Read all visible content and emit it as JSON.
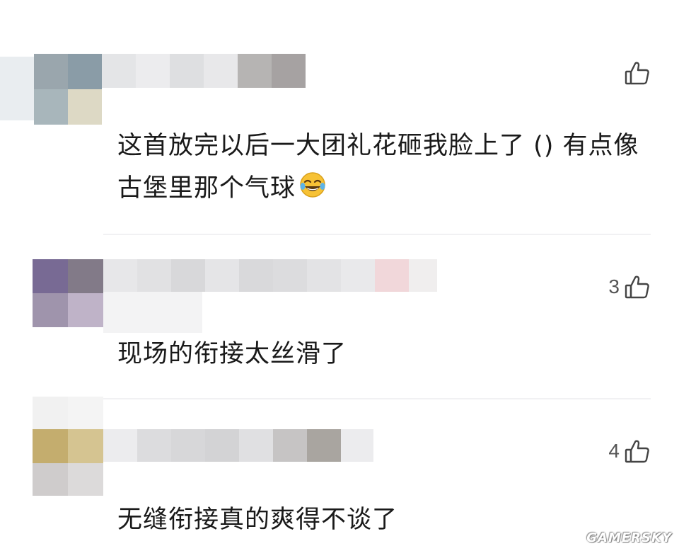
{
  "comments": [
    {
      "text": "这首放完以后一大团礼花砸我脸上了 () 有点像古堡里那个气球",
      "likes": "",
      "emoji_icon": "tears-of-joy-emoji"
    },
    {
      "text": "现场的衔接太丝滑了",
      "likes": "3"
    },
    {
      "text": "无缝衔接真的爽得不谈了",
      "likes": "4"
    }
  ],
  "like_icon": "thumbs-up-outline-icon",
  "watermark": "GAMERSKY",
  "colors": {
    "text": "#1a1a1a",
    "count": "#555555",
    "divider": "#f1f1f3",
    "background": "#ffffff"
  }
}
